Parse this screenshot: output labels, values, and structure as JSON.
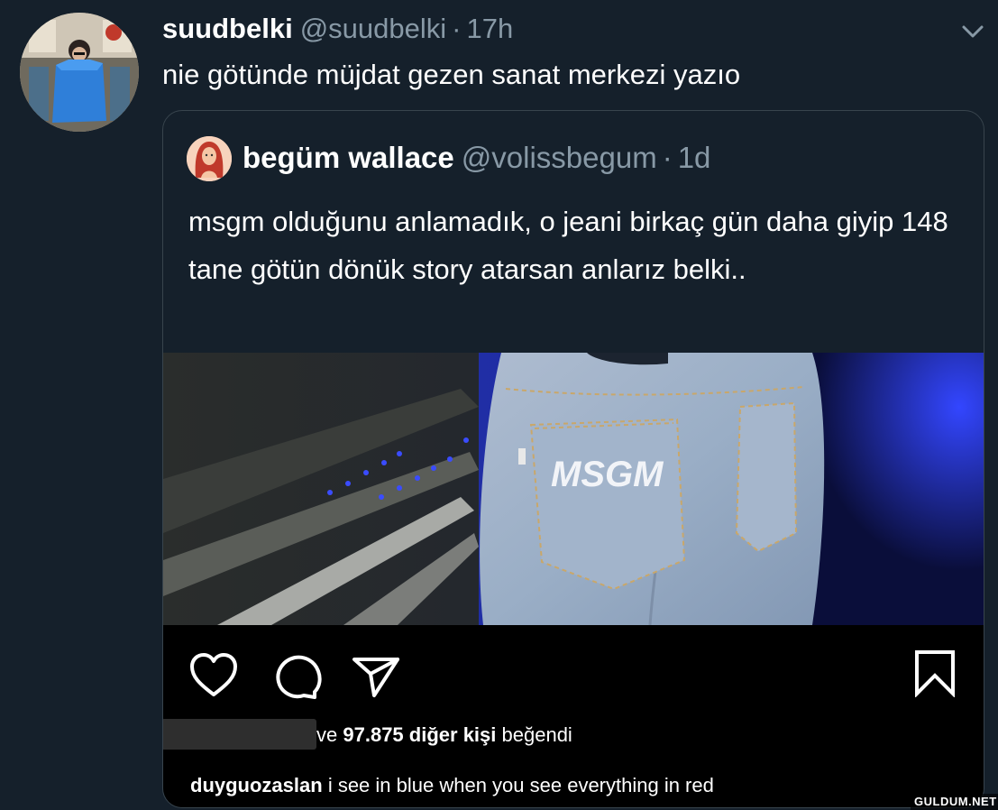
{
  "tweet": {
    "display_name": "suudbelki",
    "handle": "@suudbelki",
    "separator": "·",
    "time": "17h",
    "text": "nie götünde müjdat gezen sanat merkezi yazıo"
  },
  "quoted_tweet": {
    "display_name": "begüm wallace",
    "handle": "@volissbegum",
    "separator": "·",
    "time": "1d",
    "text": "msgm olduğunu  anlamadık, o jeani birkaç gün daha giyip 148 tane götün dönük story atarsan anlarız belki..",
    "photo_text": "MSGM"
  },
  "instagram": {
    "likes_prefix": "ve",
    "likes_count": "97.875",
    "likes_others": "diğer kişi",
    "likes_suffix": "beğendi",
    "comment_user": "duyguozaslan",
    "comment_text": "i see in blue when you see everything in red"
  },
  "watermark": "GULDUM.NET",
  "icons": {
    "chevron": "chevron-down-icon",
    "like": "heart-icon",
    "comment": "comment-bubble-icon",
    "share": "paper-plane-icon",
    "save": "bookmark-icon"
  },
  "colors": {
    "background": "#15202b",
    "secondary_text": "#8899a6",
    "border": "#38444d",
    "instagram_bg": "#000000",
    "accent_blue": "#2a3cff"
  }
}
